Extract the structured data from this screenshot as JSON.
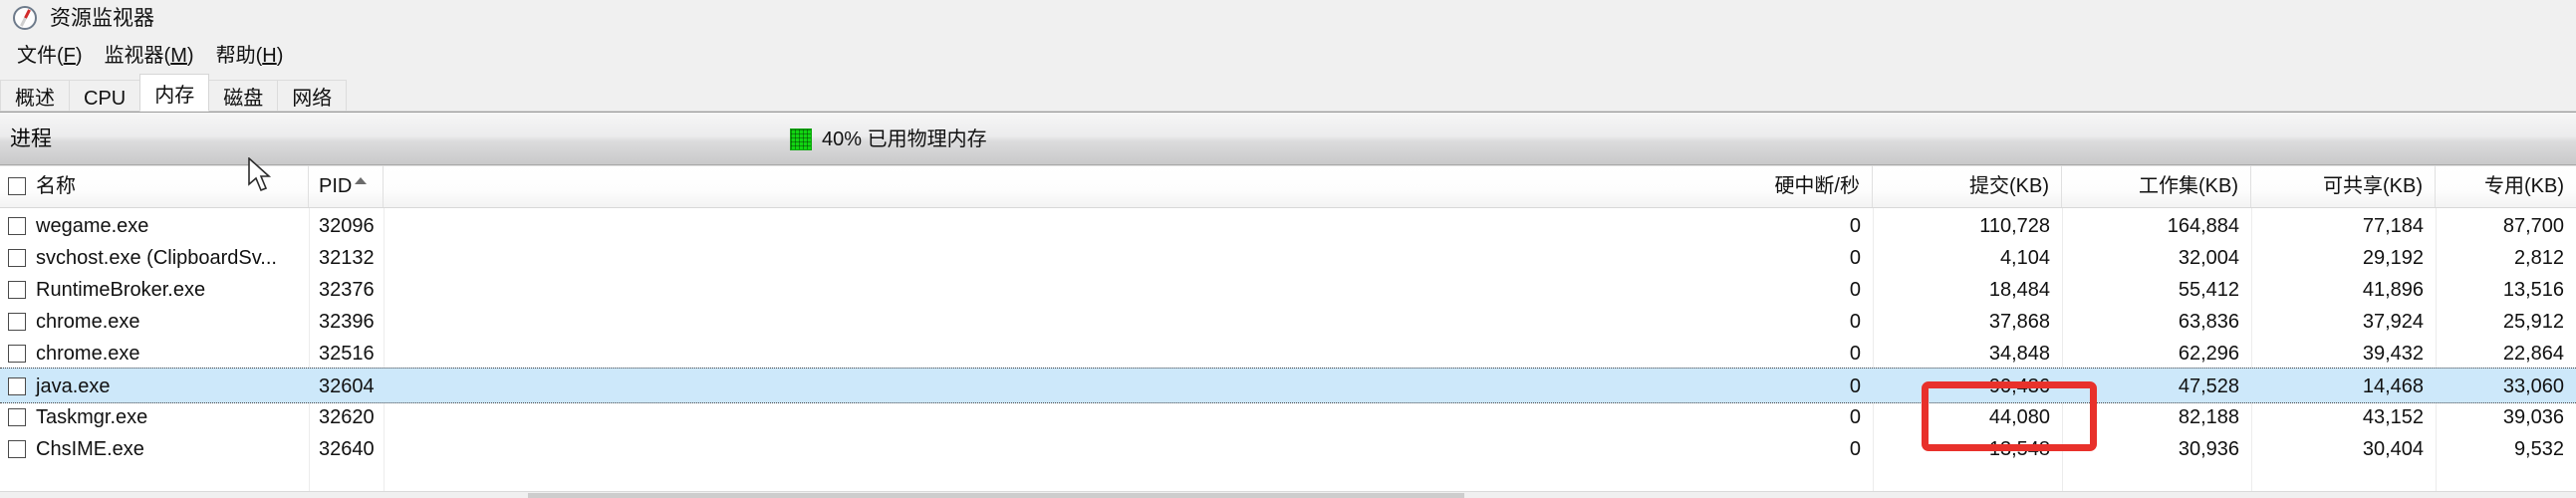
{
  "window": {
    "title": "资源监视器",
    "icon": "compass-icon"
  },
  "menu": {
    "items": [
      {
        "label": "文件(F)",
        "text": "文件(",
        "accel": "F",
        "tail": ")"
      },
      {
        "label": "监视器(M)",
        "text": "监视器(",
        "accel": "M",
        "tail": ")"
      },
      {
        "label": "帮助(H)",
        "text": "帮助(",
        "accel": "H",
        "tail": ")"
      }
    ]
  },
  "tabs": {
    "active": "内存",
    "items": [
      {
        "label": "概述"
      },
      {
        "label": "CPU"
      },
      {
        "label": "内存"
      },
      {
        "label": "磁盘"
      },
      {
        "label": "网络"
      }
    ]
  },
  "section": {
    "title": "进程",
    "memory_indicator": {
      "swatch_color": "#12d412",
      "label": "40% 已用物理内存",
      "percent": "40%"
    }
  },
  "table": {
    "sort_column": "PID",
    "sort_direction": "ascending",
    "columns": [
      {
        "key": "name",
        "label": "名称",
        "align": "left"
      },
      {
        "key": "pid",
        "label": "PID",
        "align": "left"
      },
      {
        "key": "hardfaults",
        "label": "硬中断/秒",
        "align": "right"
      },
      {
        "key": "commit",
        "label": "提交(KB)",
        "align": "right"
      },
      {
        "key": "workingset",
        "label": "工作集(KB)",
        "align": "right"
      },
      {
        "key": "shareable",
        "label": "可共享(KB)",
        "align": "right"
      },
      {
        "key": "private",
        "label": "专用(KB)",
        "align": "right"
      }
    ],
    "rows": [
      {
        "name": "wegame.exe",
        "pid": "32096",
        "hardfaults": "0",
        "commit": "110,728",
        "workingset": "164,884",
        "shareable": "77,184",
        "private": "87,700",
        "selected": false
      },
      {
        "name": "svchost.exe (ClipboardSv...",
        "pid": "32132",
        "hardfaults": "0",
        "commit": "4,104",
        "workingset": "32,004",
        "shareable": "29,192",
        "private": "2,812",
        "selected": false
      },
      {
        "name": "RuntimeBroker.exe",
        "pid": "32376",
        "hardfaults": "0",
        "commit": "18,484",
        "workingset": "55,412",
        "shareable": "41,896",
        "private": "13,516",
        "selected": false
      },
      {
        "name": "chrome.exe",
        "pid": "32396",
        "hardfaults": "0",
        "commit": "37,868",
        "workingset": "63,836",
        "shareable": "37,924",
        "private": "25,912",
        "selected": false
      },
      {
        "name": "chrome.exe",
        "pid": "32516",
        "hardfaults": "0",
        "commit": "34,848",
        "workingset": "62,296",
        "shareable": "39,432",
        "private": "22,864",
        "selected": false
      },
      {
        "name": "java.exe",
        "pid": "32604",
        "hardfaults": "0",
        "commit": "90,436",
        "workingset": "47,528",
        "shareable": "14,468",
        "private": "33,060",
        "selected": true
      },
      {
        "name": "Taskmgr.exe",
        "pid": "32620",
        "hardfaults": "0",
        "commit": "44,080",
        "workingset": "82,188",
        "shareable": "43,152",
        "private": "39,036",
        "selected": false
      },
      {
        "name": "ChsIME.exe",
        "pid": "32640",
        "hardfaults": "0",
        "commit": "13,548",
        "workingset": "30,936",
        "shareable": "30,404",
        "private": "9,532",
        "selected": false
      }
    ]
  },
  "annotation": {
    "color": "#e8312b",
    "target_row": "java.exe",
    "target_column": "提交(KB)",
    "target_value": "90,436"
  }
}
